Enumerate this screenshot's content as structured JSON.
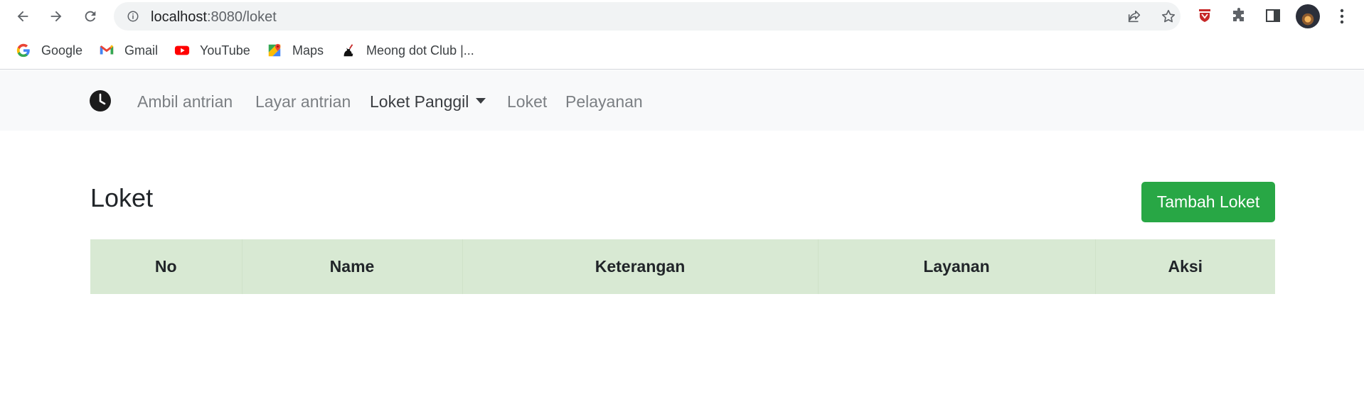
{
  "browser": {
    "url_host": "localhost",
    "url_rest": ":8080/loket",
    "bookmarks": [
      {
        "label": "Google",
        "icon": "google-icon"
      },
      {
        "label": "Gmail",
        "icon": "gmail-icon"
      },
      {
        "label": "YouTube",
        "icon": "youtube-icon"
      },
      {
        "label": "Maps",
        "icon": "maps-icon"
      },
      {
        "label": "Meong dot Club |...",
        "icon": "cat-icon"
      }
    ]
  },
  "navbar": {
    "brand_icon": "clock-icon",
    "links": [
      {
        "label": "Ambil antrian"
      },
      {
        "label": "Layar antrian"
      },
      {
        "label": "Loket Panggil"
      },
      {
        "label": "Loket"
      },
      {
        "label": "Pelayanan"
      }
    ]
  },
  "page": {
    "title": "Loket",
    "add_button": "Tambah Loket"
  },
  "table": {
    "columns": [
      "No",
      "Name",
      "Keterangan",
      "Layanan",
      "Aksi"
    ],
    "rows": []
  },
  "colors": {
    "success": "#28a745",
    "table_header": "#d8e9d3",
    "navbar_bg": "#f8f9fa"
  }
}
